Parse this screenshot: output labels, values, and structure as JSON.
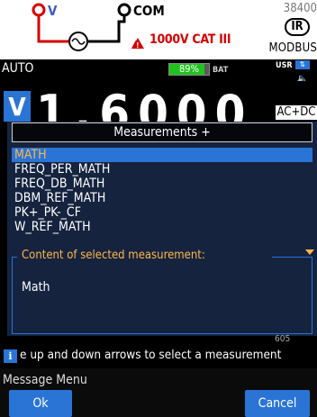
{
  "terminals": {
    "v_label": "V",
    "com_label": "COM",
    "cat_rating": "1000V CAT III",
    "model_number": "38400",
    "ir_label": "IR",
    "protocol": "MODBUS"
  },
  "status": {
    "mode": "AUTO",
    "battery_percent": 89,
    "battery_text": "89%",
    "battery_label": "BAT",
    "user_label": "USR"
  },
  "reading": {
    "unit": "V",
    "value": "1.6000",
    "coupling": "AC+DC"
  },
  "dialog": {
    "title": "Measurements +",
    "items": [
      {
        "label": "MATH",
        "selected": true
      },
      {
        "label": "FREQ_PER_MATH",
        "selected": false
      },
      {
        "label": "FREQ_DB_MATH",
        "selected": false
      },
      {
        "label": "DBM_REF_MATH",
        "selected": false
      },
      {
        "label": "PK+_PK-_CF",
        "selected": false
      },
      {
        "label": "W_REF_MATH",
        "selected": false
      }
    ],
    "content_label": "Content of selected measurement:",
    "content_value": "Math"
  },
  "below_dialog_text": "605",
  "hint": {
    "text": "e up and down arrows to select a measurement"
  },
  "menu": {
    "title": "Message Menu",
    "ok_label": "Ok",
    "cancel_label": "Cancel"
  },
  "colors": {
    "accent_blue": "#2a74d6",
    "highlight_orange": "#ffb84a",
    "dialog_bg": "#15233f",
    "battery_green": "#21c21e",
    "alert_red": "#d40000"
  }
}
